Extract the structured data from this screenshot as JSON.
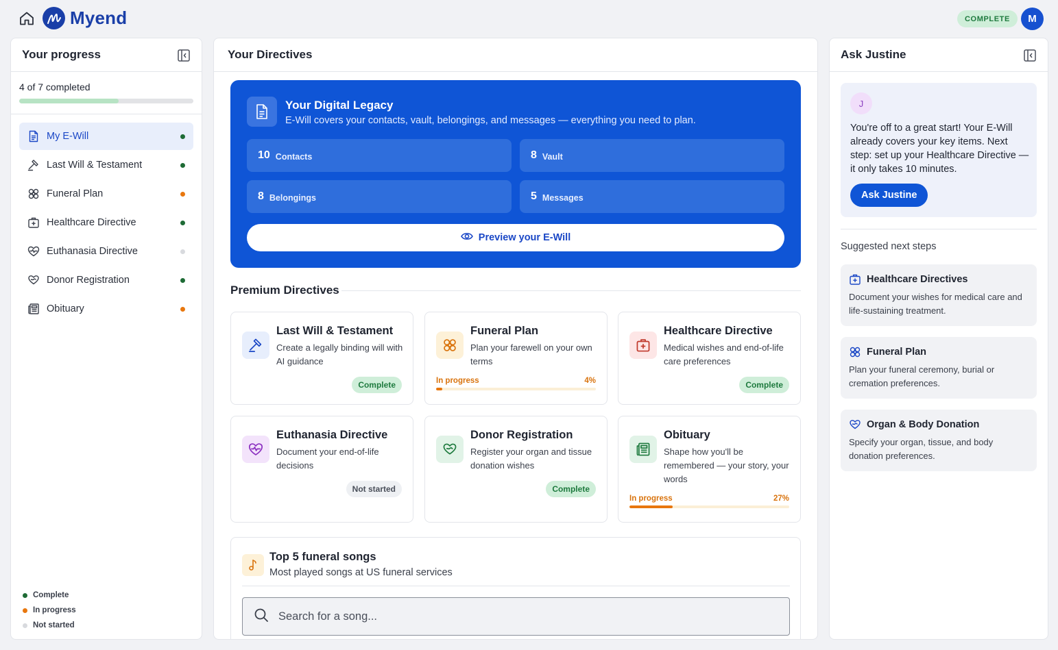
{
  "app": {
    "brand": "Myend",
    "status": "COMPLETE",
    "user_initial": "M"
  },
  "colors": {
    "accent": "#0f55d6",
    "complete": "#1e7a3e",
    "in_progress": "#e8770e",
    "not_started": "#d8dade"
  },
  "left": {
    "title": "Your progress",
    "progress_text": "4 of 7 completed",
    "progress_fraction": 0.57,
    "items": [
      {
        "label": "My E-Will",
        "icon": "document-icon",
        "status": "complete",
        "active": true
      },
      {
        "label": "Last Will & Testament",
        "icon": "gavel-icon",
        "status": "complete"
      },
      {
        "label": "Funeral Plan",
        "icon": "flower-icon",
        "status": "in-progress"
      },
      {
        "label": "Healthcare Directive",
        "icon": "medical-bag-icon",
        "status": "complete"
      },
      {
        "label": "Euthanasia Directive",
        "icon": "heart-pulse-icon",
        "status": "not-started"
      },
      {
        "label": "Donor Registration",
        "icon": "hand-heart-icon",
        "status": "complete"
      },
      {
        "label": "Obituary",
        "icon": "newspaper-icon",
        "status": "in-progress"
      }
    ],
    "legend": {
      "complete": "Complete",
      "in_progress": "In progress",
      "not_started": "Not started"
    }
  },
  "middle": {
    "title": "Your Directives",
    "hero": {
      "title": "Your Digital Legacy",
      "subtitle": "E-Will covers your contacts, vault, belongings, and messages — everything you need to plan.",
      "stats": [
        {
          "num": "10",
          "label": "Contacts"
        },
        {
          "num": "8",
          "label": "Vault"
        },
        {
          "num": "8",
          "label": "Belongings"
        },
        {
          "num": "5",
          "label": "Messages"
        }
      ],
      "preview_label": "Preview your E-Will"
    },
    "premium_title": "Premium Directives",
    "cards": [
      {
        "title": "Last Will & Testament",
        "desc": "Create a legally binding will with AI guidance",
        "status": "Complete"
      },
      {
        "title": "Funeral Plan",
        "desc": "Plan your farewell on your own terms",
        "status": "In progress",
        "percent": "4%",
        "fraction": 0.04
      },
      {
        "title": "Healthcare Directive",
        "desc": "Medical wishes and end-of-life care preferences",
        "status": "Complete"
      },
      {
        "title": "Euthanasia Directive",
        "desc": "Document your end-of-life decisions",
        "status": "Not started"
      },
      {
        "title": "Donor Registration",
        "desc": "Register your organ and tissue donation wishes",
        "status": "Complete"
      },
      {
        "title": "Obituary",
        "desc": "Shape how you'll be remembered — your story, your words",
        "status": "In progress",
        "percent": "27%",
        "fraction": 0.27
      }
    ],
    "songs": {
      "title": "Top 5 funeral songs",
      "subtitle": "Most played songs at US funeral services",
      "search_placeholder": "Search for a song..."
    }
  },
  "right": {
    "title": "Ask Justine",
    "assistant_initial": "J",
    "message": "You're off to a great start! Your E-Will already covers your key items. Next step: set up your Healthcare Directive — it only takes 10 minutes.",
    "button": "Ask Justine",
    "suggest_title": "Suggested next steps",
    "suggestions": [
      {
        "title": "Healthcare Directives",
        "desc": "Document your wishes for medical care and life-sustaining treatment.",
        "icon": "medical-bag-icon"
      },
      {
        "title": "Funeral Plan",
        "desc": "Plan your funeral ceremony, burial or cremation preferences.",
        "icon": "flower-icon"
      },
      {
        "title": "Organ & Body Donation",
        "desc": "Specify your organ, tissue, and body donation preferences.",
        "icon": "hand-heart-icon"
      }
    ]
  }
}
